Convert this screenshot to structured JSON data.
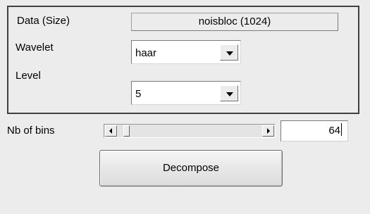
{
  "panel": {
    "data_label": "Data  (Size)",
    "data_value": "noisbloc  (1024)",
    "wavelet_label": "Wavelet",
    "wavelet_value": "haar",
    "level_label": "Level",
    "level_value": "5"
  },
  "bins": {
    "label": "Nb of bins",
    "value": "64",
    "slider_position_fraction": 0.04
  },
  "decompose_label": "Decompose",
  "icons": {
    "dropdown": "chevron-down-icon",
    "scroll_left": "arrow-left-icon",
    "scroll_right": "arrow-right-icon"
  }
}
